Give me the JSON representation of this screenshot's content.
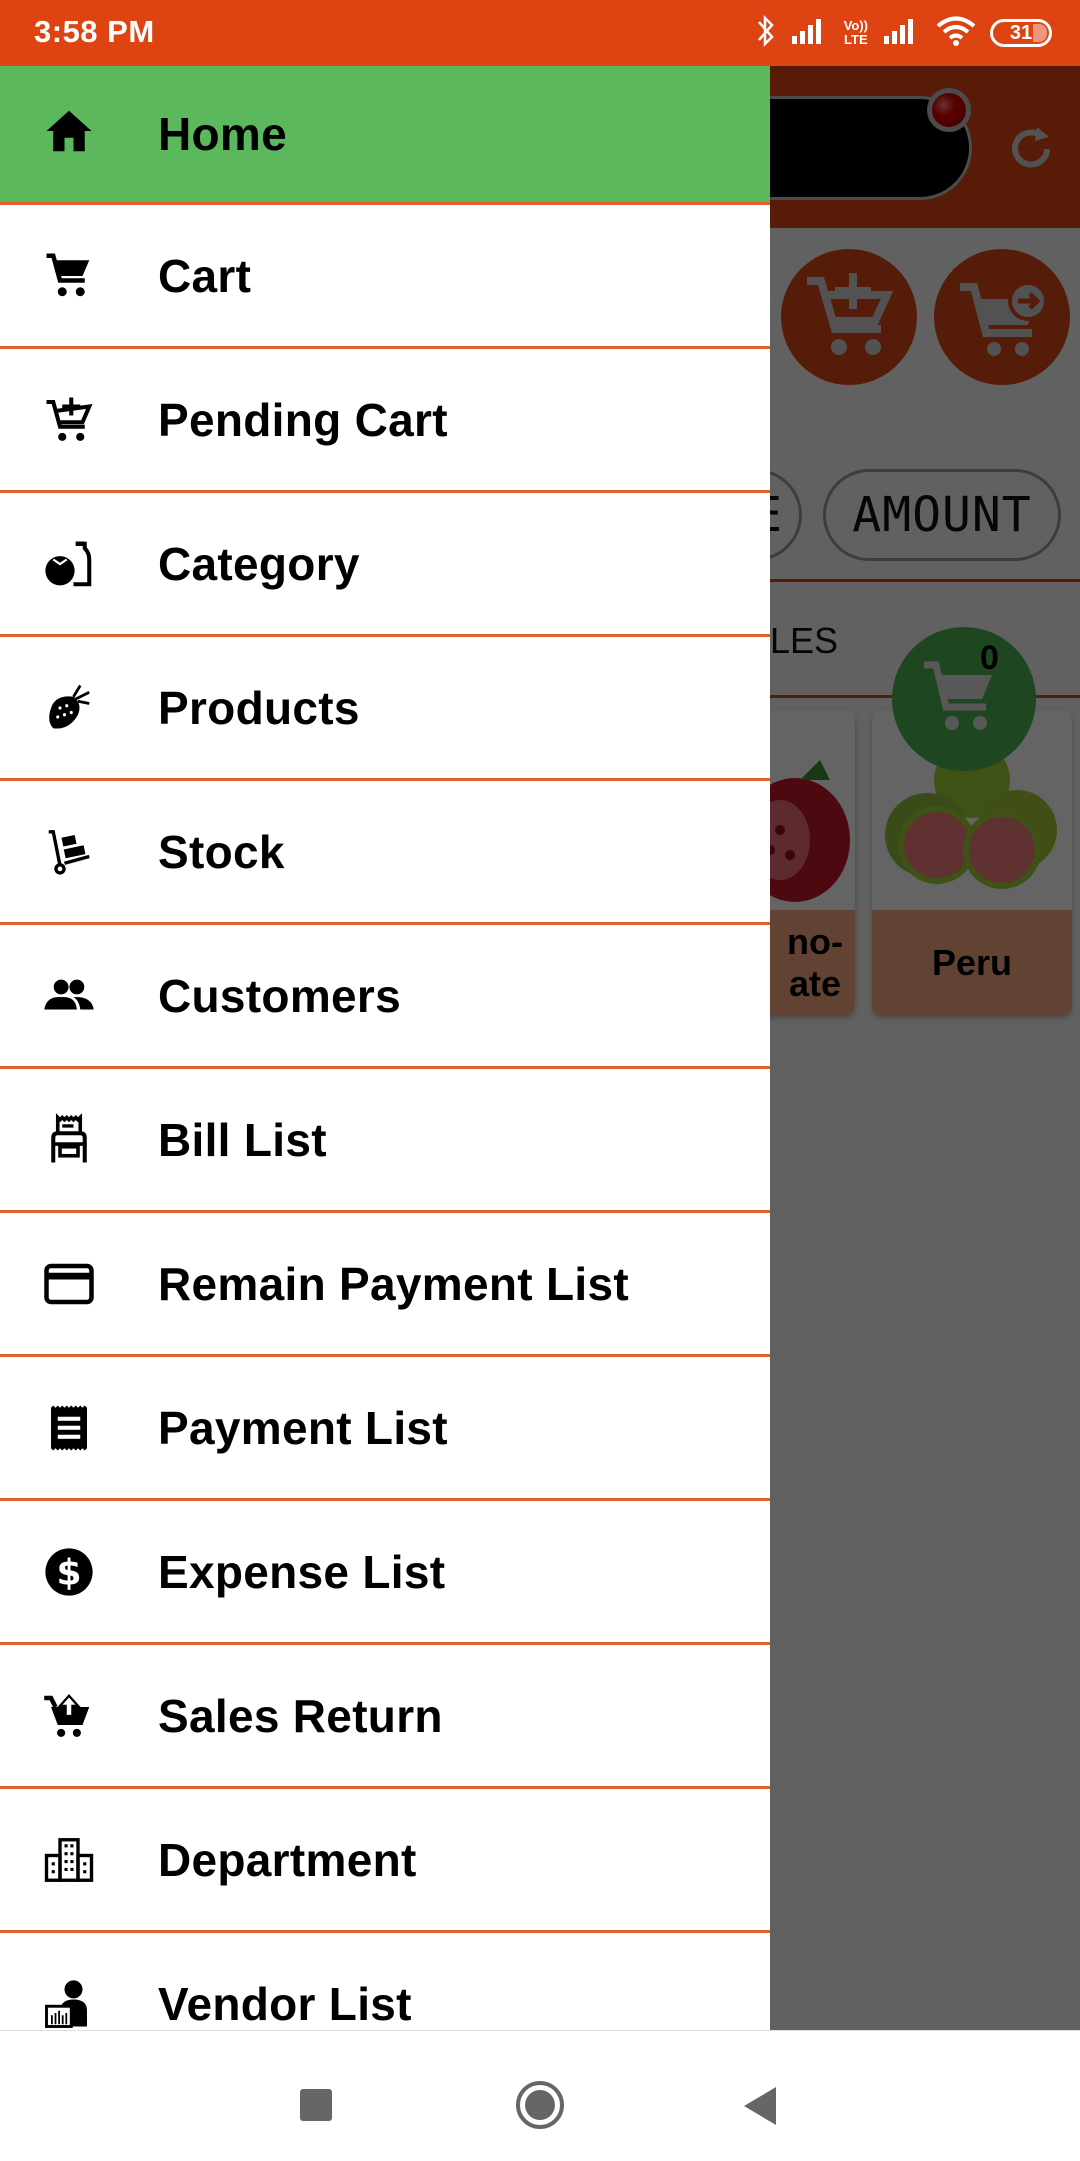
{
  "status_bar": {
    "time": "3:58 PM",
    "battery": "31",
    "icons": [
      "bluetooth-icon",
      "signal-icon",
      "volte-icon",
      "signal-icon",
      "wifi-icon",
      "battery-icon"
    ],
    "volte_label_top": "Vo))",
    "volte_label_bottom": "LTE",
    "color": "#DD4412"
  },
  "drawer": {
    "active_color": "#5CB85C",
    "divider_color": "#E06030",
    "items": [
      {
        "label": "Home",
        "icon": "home-icon",
        "active": true
      },
      {
        "label": "Cart",
        "icon": "cart-icon"
      },
      {
        "label": "Pending Cart",
        "icon": "cart-plus-icon"
      },
      {
        "label": "Category",
        "icon": "grocery-icon"
      },
      {
        "label": "Products",
        "icon": "strawberry-icon"
      },
      {
        "label": "Stock",
        "icon": "hand-truck-icon"
      },
      {
        "label": "Customers",
        "icon": "people-icon"
      },
      {
        "label": "Bill List",
        "icon": "cash-register-icon"
      },
      {
        "label": "Remain Payment List",
        "icon": "credit-card-icon"
      },
      {
        "label": "Payment List",
        "icon": "receipt-icon"
      },
      {
        "label": "Expense List",
        "icon": "dollar-icon"
      },
      {
        "label": "Sales Return",
        "icon": "cart-return-icon"
      },
      {
        "label": "Department",
        "icon": "building-icon"
      },
      {
        "label": "Vendor List",
        "icon": "vendor-icon"
      }
    ]
  },
  "background_app": {
    "pill_left_text": "E",
    "pill_amount_text": "AMOUNT",
    "tab_text": "LES",
    "cart_count": "0",
    "cards": [
      {
        "name": "no-\nate"
      },
      {
        "name": "Peru"
      }
    ]
  },
  "nav_bar": {
    "buttons": [
      "recents",
      "home",
      "back"
    ]
  }
}
